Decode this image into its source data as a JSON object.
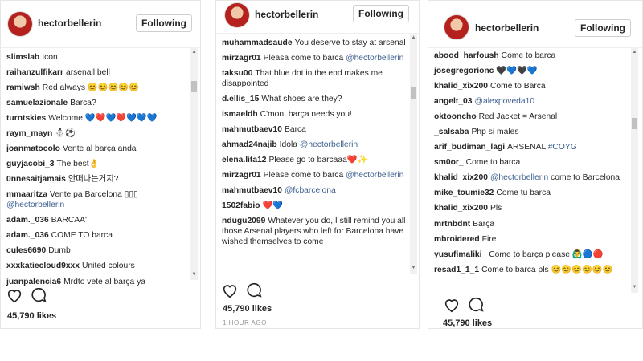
{
  "posts": [
    {
      "username": "hectorbellerin",
      "follow_label": "Following",
      "likes": "45,790 likes",
      "comments": [
        {
          "user": "slimslab",
          "text": "Icon"
        },
        {
          "user": "raihanzulfikarr",
          "text": "arsenall bell"
        },
        {
          "user": "ramiwsh",
          "text": "Red always 😊😊😊😊😊"
        },
        {
          "user": "samuelazionale",
          "text": "Barca?"
        },
        {
          "user": "turntskies",
          "text": "Welcome 💙❤️💙❤️💙💙💙"
        },
        {
          "user": "raym_mayn",
          "text": "⛄⚽"
        },
        {
          "user": "joanmatocolo",
          "text": "Vente al barça anda"
        },
        {
          "user": "guyjacobi_3",
          "text": "The best👌"
        },
        {
          "user": "0nnesaitjamais",
          "text": "안떠나는거지?"
        },
        {
          "user": "mmaaritza",
          "text": "Vente pa Barcelona ▯▯▯",
          "mention": "@hectorbellerin"
        },
        {
          "user": "adam._036",
          "text": "BARCAA'"
        },
        {
          "user": "adam._036",
          "text": "COME TO barca"
        },
        {
          "user": "cules6690",
          "text": "Dumb"
        },
        {
          "user": "xxxkatiecloud9xxx",
          "text": "United colours"
        },
        {
          "user": "juanpalencia6",
          "text": "Mrdto vete al barça ya"
        }
      ]
    },
    {
      "username": "hectorbellerin",
      "follow_label": "Following",
      "likes": "45,790 likes",
      "time": "1 HOUR AGO",
      "comments": [
        {
          "user": "muhammadsaude",
          "text": "You deserve to stay at arsenal"
        },
        {
          "user": "mirzagr01",
          "text": "Pleasa come to barca",
          "mention": "@hectorbellerin"
        },
        {
          "user": "taksu00",
          "text": "That blue dot in the end makes me disappointed"
        },
        {
          "user": "d.ellis_15",
          "text": "What shoes are they?"
        },
        {
          "user": "ismaeldh",
          "text": "C'mon, barça needs you!"
        },
        {
          "user": "mahmutbaev10",
          "text": "Barca"
        },
        {
          "user": "ahmad24najib",
          "text": "Idola",
          "mention": "@hectorbellerin"
        },
        {
          "user": "elena.lita12",
          "text": "Please go to barcaaa❤️✨"
        },
        {
          "user": "mirzagr01",
          "text": "Please come to barca",
          "mention": "@hectorbellerin"
        },
        {
          "user": "mahmutbaev10",
          "text": "",
          "mention": "@fcbarcelona"
        },
        {
          "user": "1502fabio",
          "text": "❤️💙"
        },
        {
          "user": "ndugu2099",
          "text": "Whatever you do, I still remind you all those Arsenal players who left for Barcelona have wished themselves to come"
        }
      ]
    },
    {
      "username": "hectorbellerin",
      "follow_label": "Following",
      "likes": "45,790 likes",
      "comments": [
        {
          "user": "abood_harfoush",
          "text": "Come to barca"
        },
        {
          "user": "josegregorionc",
          "text": "🖤💙🖤💙"
        },
        {
          "user": "khalid_xix200",
          "text": "Come to Barca"
        },
        {
          "user": "angelt_03",
          "text": "",
          "mention": "@alexpoveda10"
        },
        {
          "user": "oktooncho",
          "text": "Red Jacket = Arsenal"
        },
        {
          "user": "_salsaba",
          "text": "Php si males"
        },
        {
          "user": "arif_budiman_lagi",
          "text": "ARSENAL",
          "mention": "#COYG"
        },
        {
          "user": "sm0or_",
          "text": "Come to barca"
        },
        {
          "user": "khalid_xix200",
          "text": "",
          "mention": "@hectorbellerin",
          "after": "come to Barcelona"
        },
        {
          "user": "mike_toumie32",
          "text": "Come tu barca"
        },
        {
          "user": "khalid_xix200",
          "text": "Pls"
        },
        {
          "user": "mrtnbdnt",
          "text": "Barça"
        },
        {
          "user": "mbroidered",
          "text": "Fire"
        },
        {
          "user": "yusufimaliki_",
          "text": "Come to barça please 🙆‍♂️🔵🔴"
        },
        {
          "user": "resad1_1_1",
          "text": "Come to barca pls 😊😊😊😊😊😊"
        }
      ]
    }
  ]
}
